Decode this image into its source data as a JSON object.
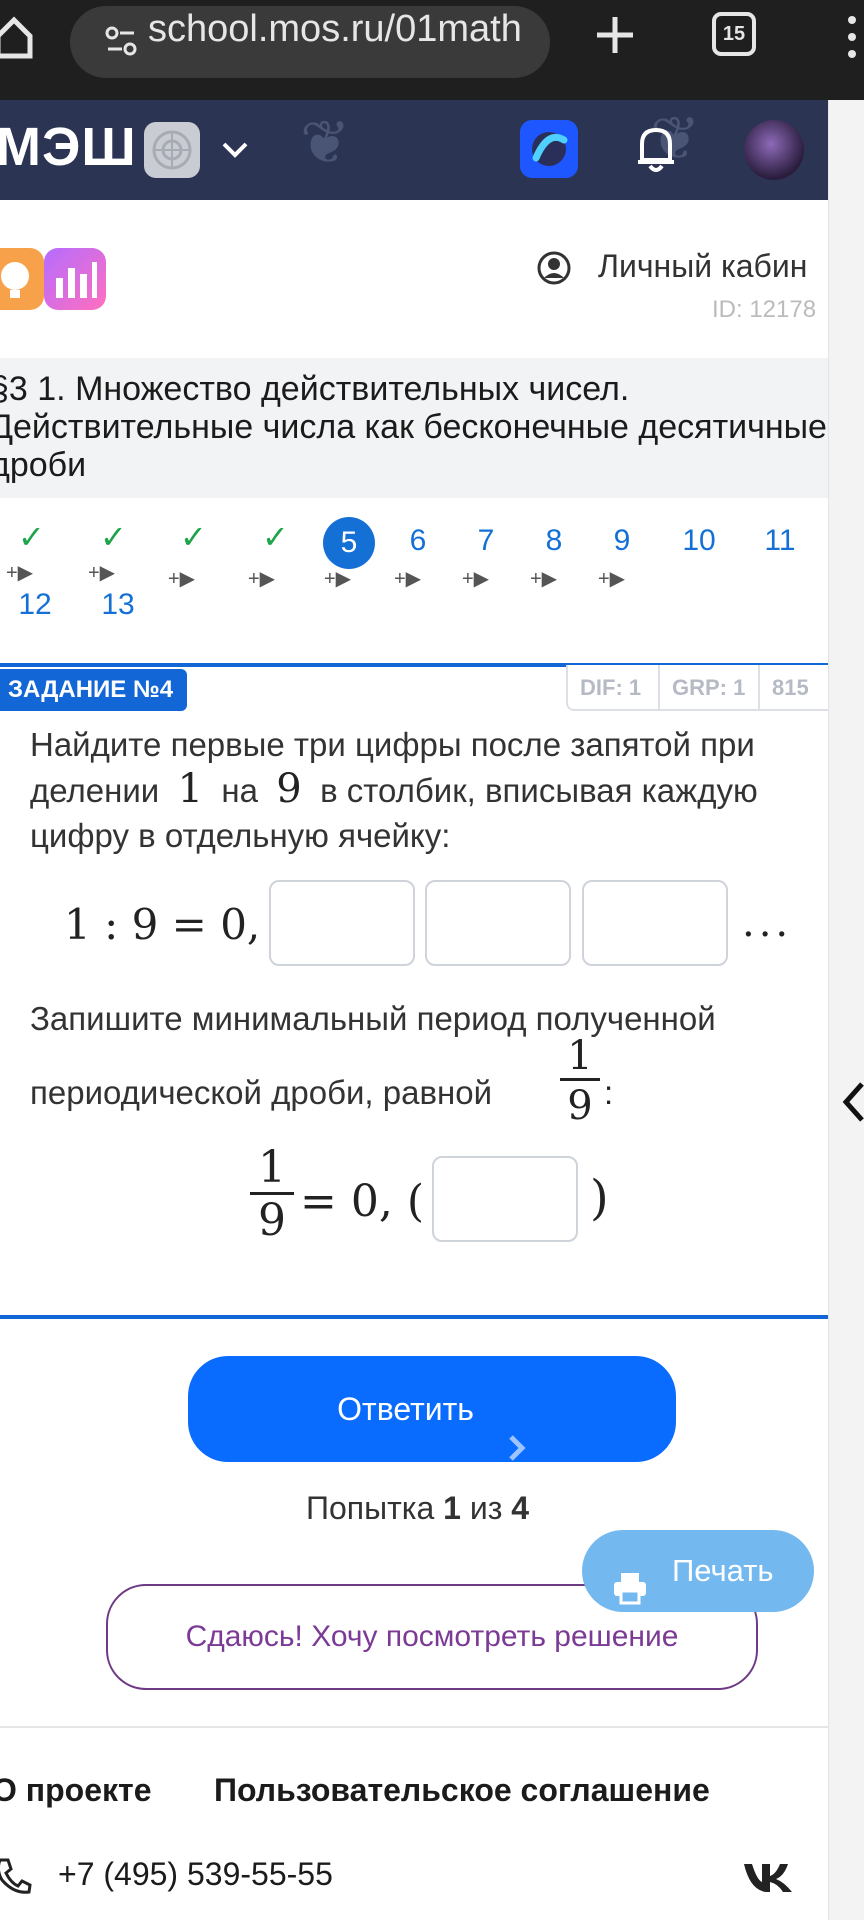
{
  "browser": {
    "url": "school.mos.ru/01math",
    "tab_count": "15"
  },
  "header": {
    "brand": "МЭШ"
  },
  "account": {
    "label": "Личный кабин",
    "id": "ID: 12178"
  },
  "lesson": {
    "title_line1": "§3 1. Множество действительных чисел.",
    "title_line2": "Действительные числа как бесконечные десятичные",
    "title_line3": "дроби"
  },
  "progress": {
    "done": [
      "✓",
      "✓",
      "✓",
      "✓"
    ],
    "current": "5",
    "next": [
      "6",
      "7",
      "8",
      "9",
      "10",
      "11"
    ],
    "row2": [
      "12",
      "13"
    ],
    "video_marker": "+▶"
  },
  "task": {
    "badge": "ЗАДАНИЕ №4",
    "dif": "DIF: 1",
    "grp": "GRP: 1",
    "code": "815",
    "text_line1": "Найдите первые три цифры после запятой при",
    "text_line2_a": "делении",
    "num_1": "1",
    "text_line2_b": "на",
    "num_9": "9",
    "text_line2_c": "в столбик, вписывая каждую",
    "text_line3": "цифру в отдельную ячейку:",
    "equation": "1 : 9 = 0,",
    "ellipsis": "...",
    "period_line1": "Запишите минимальный период полученной",
    "period_line2": "периодической дроби, равной",
    "frac_num": "1",
    "frac_den": "9",
    "colon": ":",
    "period_eq": "= 0, (",
    "period_close": ")"
  },
  "actions": {
    "answer": "Ответить",
    "attempt_prefix": "Попытка",
    "attempt_current": "1",
    "attempt_of": "из",
    "attempt_total": "4",
    "print": "Печать",
    "give_up": "Сдаюсь! Хочу посмотреть решение"
  },
  "footer": {
    "about": "О проекте",
    "terms": "Пользовательское соглашение",
    "phone": "+7 (495) 539-55-55",
    "vk": "VK"
  }
}
